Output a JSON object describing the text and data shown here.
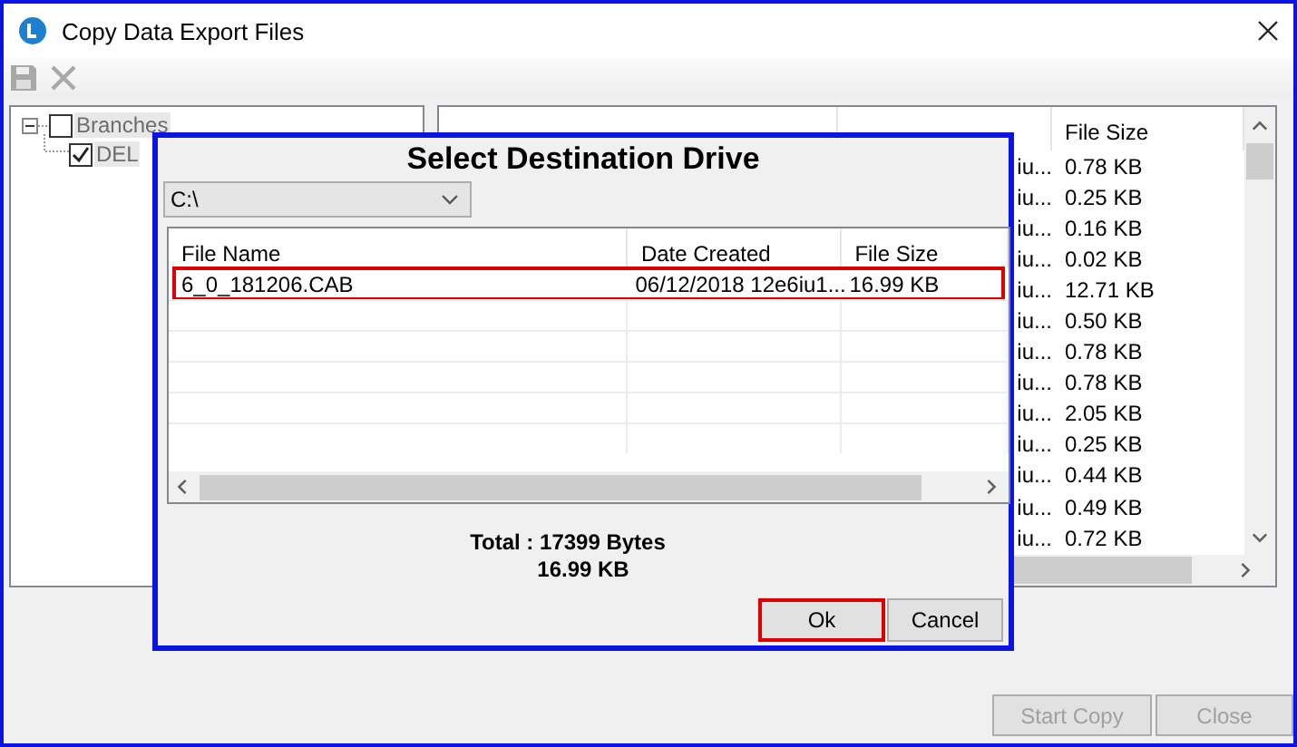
{
  "window": {
    "title": "Copy Data Export Files"
  },
  "toolbar": [
    {
      "kind": "save",
      "disabled": true
    },
    {
      "kind": "delete",
      "disabled": true
    }
  ],
  "tree": {
    "items": [
      {
        "label": "Branches",
        "checked": false,
        "expanded": true,
        "children": [
          {
            "label": "DEL",
            "checked": true
          }
        ]
      }
    ]
  },
  "file_list": {
    "columns": [
      "File Size"
    ],
    "rows": [
      {
        "date_created": "iu...",
        "file_size": "0.78 KB"
      },
      {
        "date_created": "iu...",
        "file_size": "0.25 KB"
      },
      {
        "date_created": "iu...",
        "file_size": "0.16 KB"
      },
      {
        "date_created": "iu...",
        "file_size": "0.02 KB"
      },
      {
        "date_created": "iu...",
        "file_size": "12.71 KB"
      },
      {
        "date_created": "iu...",
        "file_size": "0.50 KB"
      },
      {
        "date_created": "iu...",
        "file_size": "0.78 KB"
      },
      {
        "date_created": "iu...",
        "file_size": "0.78 KB"
      },
      {
        "date_created": "iu...",
        "file_size": "2.05 KB"
      },
      {
        "date_created": "iu...",
        "file_size": "0.25 KB"
      },
      {
        "date_created": "iu...",
        "file_size": "0.44 KB"
      },
      {
        "date_created": "iu...",
        "file_size": "0.49 KB"
      },
      {
        "date_created": "iu...",
        "file_size": "0.72 KB"
      }
    ]
  },
  "dialog": {
    "title": "Select Destination Drive",
    "drive": "C:\\",
    "columns": [
      "File Name",
      "Date Created",
      "File Size"
    ],
    "rows": [
      {
        "file_name": "6_0_181206.CAB",
        "date_created": "06/12/2018 12e6iu1...",
        "file_size": "16.99 KB",
        "selected": true
      }
    ],
    "total_bytes": "Total : 17399 Bytes",
    "total_kb": "16.99 KB",
    "buttons": [
      {
        "label": "Ok",
        "highlighted": true
      },
      {
        "label": "Cancel",
        "highlighted": false
      }
    ]
  },
  "footer_buttons": [
    {
      "label": "Start Copy",
      "disabled": true
    },
    {
      "label": "Close",
      "disabled": true
    }
  ]
}
